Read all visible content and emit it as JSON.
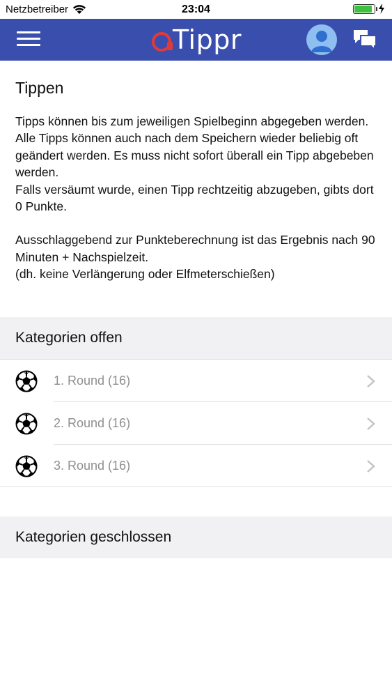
{
  "status_bar": {
    "carrier": "Netzbetreiber",
    "time": "23:04",
    "battery_level": 0.9
  },
  "nav": {
    "logo_text": "Tippr",
    "colors": {
      "bar": "#3a4fad",
      "logo_accent": "#e23a3a"
    },
    "icons": [
      "hamburger-menu-icon",
      "avatar-icon",
      "chat-bubbles-icon"
    ]
  },
  "page": {
    "title": "Tippen",
    "paragraphs": [
      "Tipps können bis zum jeweiligen Spielbeginn abgegeben werden.",
      "Alle Tipps können auch nach dem Speichern wieder beliebig oft geändert werden. Es muss nicht sofort überall ein Tipp abgebeben werden.",
      "Falls versäumt wurde, einen Tipp rechtzeitig abzugeben, gibts dort 0 Punkte.",
      "Ausschlaggebend zur Punkteberechnung ist das Ergebnis nach 90 Minuten + Nachspielzeit.",
      "(dh. keine Verlängerung oder Elfmeterschießen)"
    ]
  },
  "sections": {
    "open": {
      "header": "Kategorien offen",
      "items": [
        {
          "label": "1. Round (16)",
          "icon": "soccer-ball-icon"
        },
        {
          "label": "2. Round (16)",
          "icon": "soccer-ball-icon"
        },
        {
          "label": "3. Round (16)",
          "icon": "soccer-ball-icon"
        }
      ]
    },
    "closed": {
      "header": "Kategorien geschlossen"
    }
  }
}
